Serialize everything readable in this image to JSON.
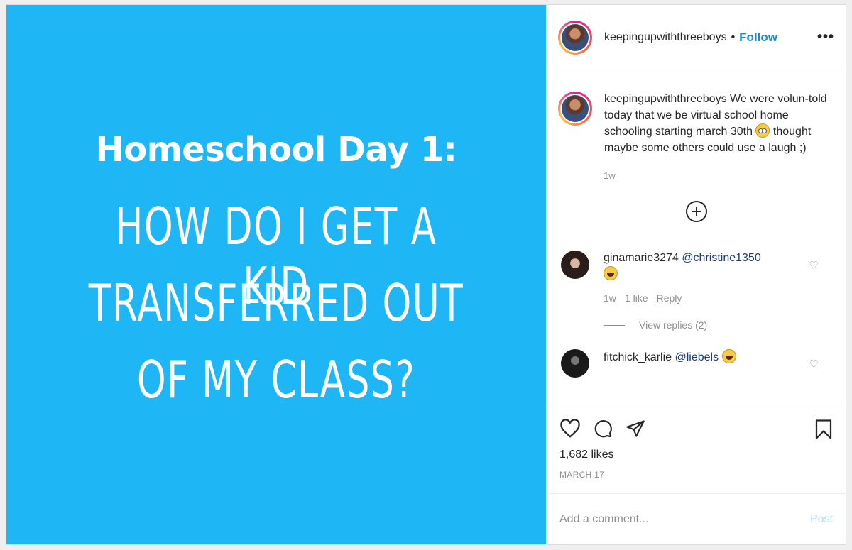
{
  "media": {
    "headline": "Homeschool Day 1:",
    "lines": [
      "HOW DO I GET A KID",
      "TRANSFERRED OUT",
      "OF MY CLASS?"
    ],
    "background_color": "#1fb6f5"
  },
  "header": {
    "username": "keepingupwiththreeboys",
    "separator": "•",
    "follow_label": "Follow",
    "more_icon": "ellipsis-icon",
    "more_label": "•••"
  },
  "caption": {
    "username": "keepingupwiththreeboys",
    "text_before_emoji": "We were volun-told today that we be virtual school home schooling starting march 30th",
    "emoji": "flushed-face-emoji",
    "text_after_emoji": "thought maybe some others could use a laugh ;)",
    "time": "1w"
  },
  "load_more_icon": "plus-circle-icon",
  "comments": [
    {
      "username": "ginamarie3274",
      "mention": "@christine1350",
      "emoji": "grinning-squinting-emoji",
      "time": "1w",
      "likes": "1 like",
      "reply_label": "Reply",
      "view_replies": "View replies (2)"
    },
    {
      "username": "fitchick_karlie",
      "mention": "@liebels",
      "emoji": "rolling-laughing-emoji"
    }
  ],
  "actions": {
    "likes": "1,682 likes",
    "date": "MARCH 17"
  },
  "add_comment": {
    "placeholder": "Add a comment...",
    "post_label": "Post"
  }
}
